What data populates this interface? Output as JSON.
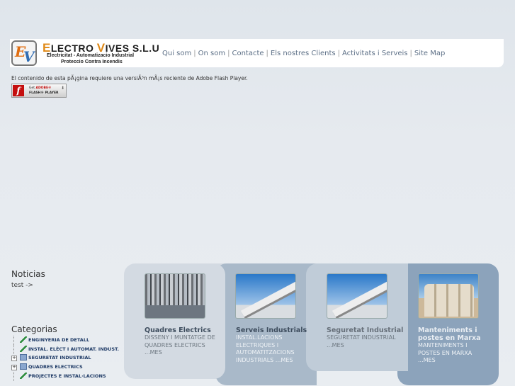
{
  "header": {
    "brand_first_letter": "E",
    "brand_rest1": "LECTRO",
    "brand_second_letter": "V",
    "brand_rest2": "IVES S.L.U",
    "tagline1": "Electricitat - Automatizacio Industrial",
    "tagline2": "Proteccio Contra Incendis",
    "logo_letters": [
      "E",
      "V"
    ]
  },
  "nav": [
    "Qui som",
    "On som",
    "Contacte",
    "Els nostres Clients",
    "Activitats i Serveis",
    "Site Map"
  ],
  "nav_separator": "|",
  "flash": {
    "message": "El contenido de esta pÃ¡gina requiere una versiÃ³n mÃ¡s reciente de Adobe Flash Player.",
    "button_get": "Get",
    "button_adobe": "ADOBE®",
    "button_player": "FLASH® PLAYER"
  },
  "news": {
    "title": "Noticias",
    "link": "test ->"
  },
  "categories": {
    "title": "Categorias",
    "items": [
      {
        "label": "ENGINYERIA DE DETALL",
        "icon": "pencil-icon",
        "expandable": false
      },
      {
        "label": "INSTAL. ELÈCT I AUTOMAT. INDUST.",
        "icon": "pencil-icon",
        "expandable": false
      },
      {
        "label": "SEGURETAT INDUSTRIAL",
        "icon": "folder-icon",
        "expandable": true
      },
      {
        "label": "QUADRES ELECTRICS",
        "icon": "folder-icon",
        "expandable": true
      },
      {
        "label": "PROJECTES E INSTAL·LACIONS",
        "icon": "pencil-icon",
        "expandable": false
      }
    ]
  },
  "cards": [
    {
      "title": "Quadres Electrics",
      "desc": "DISSENY I MUNTATGE DE QUADRES ELECTRICS   ...MES"
    },
    {
      "title": "Serveis Industrials",
      "desc": "INSTAL.LACIONS ELECTRIQUES I AUTOMATITZACIONS INDUSTRIALS   ...MES"
    },
    {
      "title": "Seguretat Industrial",
      "desc": "SEGURETAT INDUSTRIAL   ...MES"
    },
    {
      "title": "Manteniments i postes en Marxa",
      "desc": "MANTENIMENTS I POSTES EN MARXA ...MES"
    }
  ],
  "colors": {
    "accent_orange": "#e08a18",
    "accent_blue": "#2f6cb3",
    "nav_link": "#5c6f86",
    "panel1": "#d3dae2",
    "panel2": "#a9b9c9",
    "panel3": "#c0ccd8",
    "panel4": "#8ca3bb"
  }
}
